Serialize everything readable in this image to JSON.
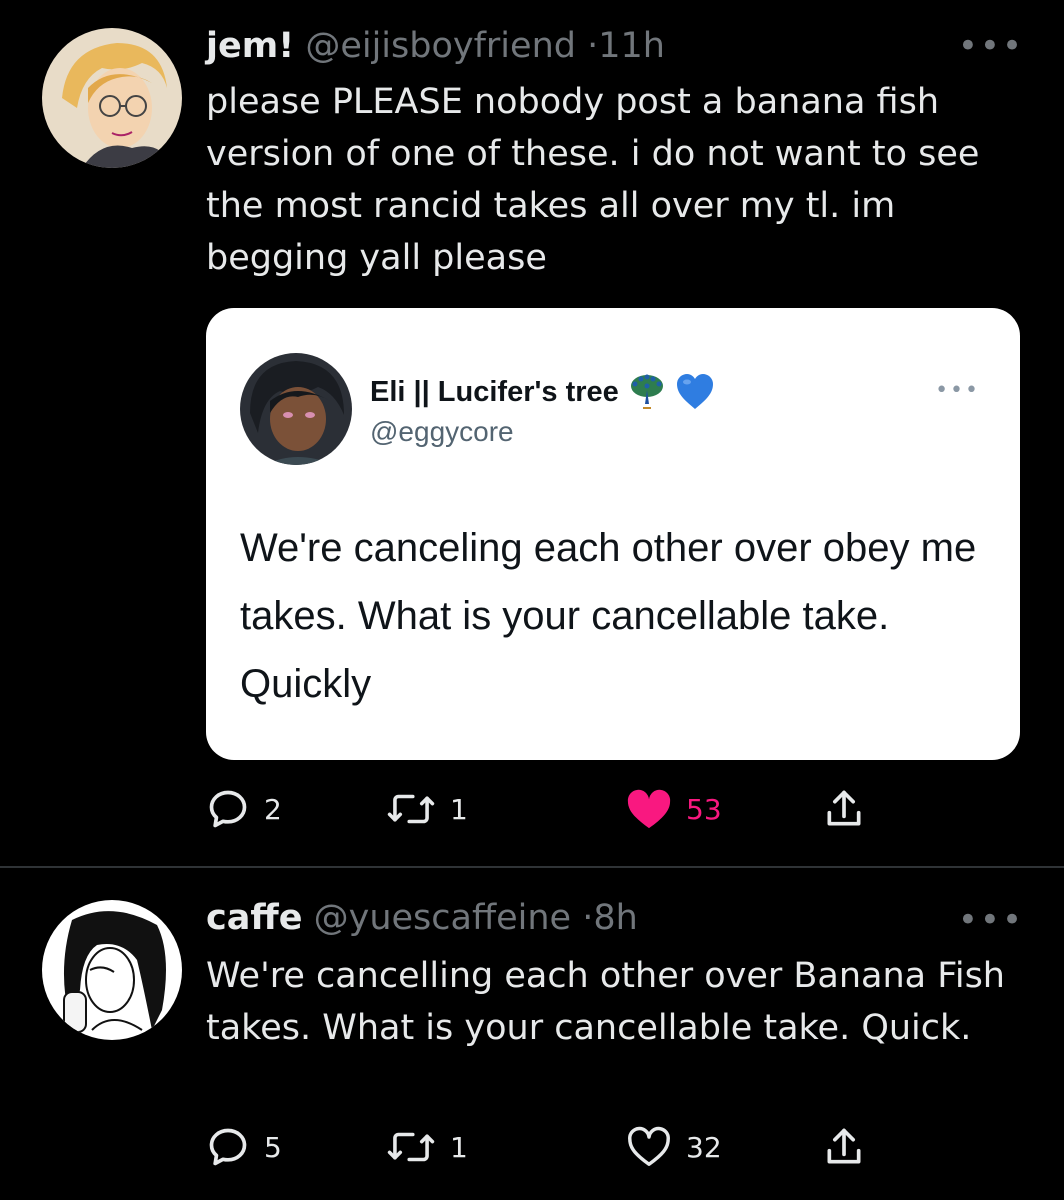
{
  "tweets": [
    {
      "name": "jem!",
      "handle": "@eijisboyfriend",
      "time": "11h",
      "text": "please PLEASE nobody post a banana fish version of one of these. i do not want to see the most rancid takes all over my tl. im begging yall please",
      "quote": {
        "name": "Eli || Lucifer's tree",
        "emoji": [
          "peacock-emoji",
          "blue-heart-emoji"
        ],
        "handle": "@eggycore",
        "text": "We're canceling each other over obey me takes. What is your cancellable take. Quickly"
      },
      "replies": "2",
      "retweets": "1",
      "likes": "53",
      "liked": true
    },
    {
      "name": "caffe",
      "handle": "@yuescaffeine",
      "time": "8h",
      "text": "We're cancelling each other over Banana Fish takes. What is your cancellable take. Quick.",
      "replies": "5",
      "retweets": "1",
      "likes": "32",
      "liked": false
    }
  ],
  "separator": "·",
  "more": "•••",
  "colors": {
    "background": "#000000",
    "text": "#e7e9ea",
    "secondary": "#71767b",
    "like": "#f91880",
    "divider": "#2f3336"
  }
}
